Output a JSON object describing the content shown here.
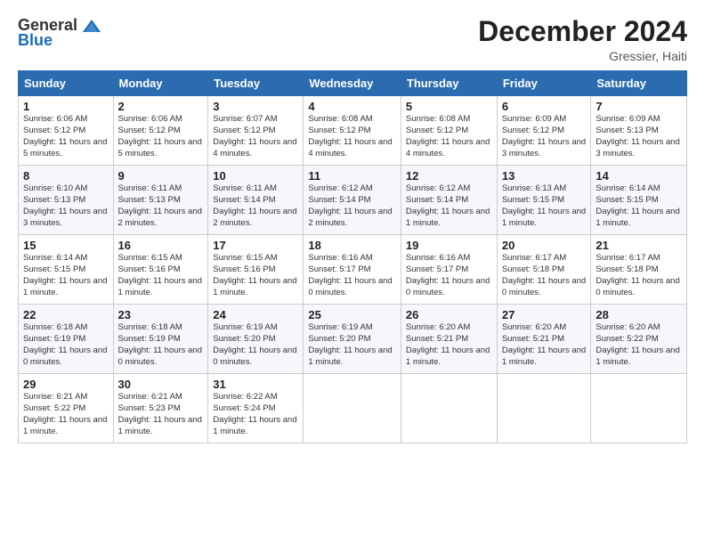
{
  "header": {
    "logo_general": "General",
    "logo_blue": "Blue",
    "month_title": "December 2024",
    "location": "Gressier, Haiti"
  },
  "days_of_week": [
    "Sunday",
    "Monday",
    "Tuesday",
    "Wednesday",
    "Thursday",
    "Friday",
    "Saturday"
  ],
  "weeks": [
    [
      {
        "num": "1",
        "sunrise": "Sunrise: 6:06 AM",
        "sunset": "Sunset: 5:12 PM",
        "daylight": "Daylight: 11 hours and 5 minutes."
      },
      {
        "num": "2",
        "sunrise": "Sunrise: 6:06 AM",
        "sunset": "Sunset: 5:12 PM",
        "daylight": "Daylight: 11 hours and 5 minutes."
      },
      {
        "num": "3",
        "sunrise": "Sunrise: 6:07 AM",
        "sunset": "Sunset: 5:12 PM",
        "daylight": "Daylight: 11 hours and 4 minutes."
      },
      {
        "num": "4",
        "sunrise": "Sunrise: 6:08 AM",
        "sunset": "Sunset: 5:12 PM",
        "daylight": "Daylight: 11 hours and 4 minutes."
      },
      {
        "num": "5",
        "sunrise": "Sunrise: 6:08 AM",
        "sunset": "Sunset: 5:12 PM",
        "daylight": "Daylight: 11 hours and 4 minutes."
      },
      {
        "num": "6",
        "sunrise": "Sunrise: 6:09 AM",
        "sunset": "Sunset: 5:12 PM",
        "daylight": "Daylight: 11 hours and 3 minutes."
      },
      {
        "num": "7",
        "sunrise": "Sunrise: 6:09 AM",
        "sunset": "Sunset: 5:13 PM",
        "daylight": "Daylight: 11 hours and 3 minutes."
      }
    ],
    [
      {
        "num": "8",
        "sunrise": "Sunrise: 6:10 AM",
        "sunset": "Sunset: 5:13 PM",
        "daylight": "Daylight: 11 hours and 3 minutes."
      },
      {
        "num": "9",
        "sunrise": "Sunrise: 6:11 AM",
        "sunset": "Sunset: 5:13 PM",
        "daylight": "Daylight: 11 hours and 2 minutes."
      },
      {
        "num": "10",
        "sunrise": "Sunrise: 6:11 AM",
        "sunset": "Sunset: 5:14 PM",
        "daylight": "Daylight: 11 hours and 2 minutes."
      },
      {
        "num": "11",
        "sunrise": "Sunrise: 6:12 AM",
        "sunset": "Sunset: 5:14 PM",
        "daylight": "Daylight: 11 hours and 2 minutes."
      },
      {
        "num": "12",
        "sunrise": "Sunrise: 6:12 AM",
        "sunset": "Sunset: 5:14 PM",
        "daylight": "Daylight: 11 hours and 1 minute."
      },
      {
        "num": "13",
        "sunrise": "Sunrise: 6:13 AM",
        "sunset": "Sunset: 5:15 PM",
        "daylight": "Daylight: 11 hours and 1 minute."
      },
      {
        "num": "14",
        "sunrise": "Sunrise: 6:14 AM",
        "sunset": "Sunset: 5:15 PM",
        "daylight": "Daylight: 11 hours and 1 minute."
      }
    ],
    [
      {
        "num": "15",
        "sunrise": "Sunrise: 6:14 AM",
        "sunset": "Sunset: 5:15 PM",
        "daylight": "Daylight: 11 hours and 1 minute."
      },
      {
        "num": "16",
        "sunrise": "Sunrise: 6:15 AM",
        "sunset": "Sunset: 5:16 PM",
        "daylight": "Daylight: 11 hours and 1 minute."
      },
      {
        "num": "17",
        "sunrise": "Sunrise: 6:15 AM",
        "sunset": "Sunset: 5:16 PM",
        "daylight": "Daylight: 11 hours and 1 minute."
      },
      {
        "num": "18",
        "sunrise": "Sunrise: 6:16 AM",
        "sunset": "Sunset: 5:17 PM",
        "daylight": "Daylight: 11 hours and 0 minutes."
      },
      {
        "num": "19",
        "sunrise": "Sunrise: 6:16 AM",
        "sunset": "Sunset: 5:17 PM",
        "daylight": "Daylight: 11 hours and 0 minutes."
      },
      {
        "num": "20",
        "sunrise": "Sunrise: 6:17 AM",
        "sunset": "Sunset: 5:18 PM",
        "daylight": "Daylight: 11 hours and 0 minutes."
      },
      {
        "num": "21",
        "sunrise": "Sunrise: 6:17 AM",
        "sunset": "Sunset: 5:18 PM",
        "daylight": "Daylight: 11 hours and 0 minutes."
      }
    ],
    [
      {
        "num": "22",
        "sunrise": "Sunrise: 6:18 AM",
        "sunset": "Sunset: 5:19 PM",
        "daylight": "Daylight: 11 hours and 0 minutes."
      },
      {
        "num": "23",
        "sunrise": "Sunrise: 6:18 AM",
        "sunset": "Sunset: 5:19 PM",
        "daylight": "Daylight: 11 hours and 0 minutes."
      },
      {
        "num": "24",
        "sunrise": "Sunrise: 6:19 AM",
        "sunset": "Sunset: 5:20 PM",
        "daylight": "Daylight: 11 hours and 0 minutes."
      },
      {
        "num": "25",
        "sunrise": "Sunrise: 6:19 AM",
        "sunset": "Sunset: 5:20 PM",
        "daylight": "Daylight: 11 hours and 1 minute."
      },
      {
        "num": "26",
        "sunrise": "Sunrise: 6:20 AM",
        "sunset": "Sunset: 5:21 PM",
        "daylight": "Daylight: 11 hours and 1 minute."
      },
      {
        "num": "27",
        "sunrise": "Sunrise: 6:20 AM",
        "sunset": "Sunset: 5:21 PM",
        "daylight": "Daylight: 11 hours and 1 minute."
      },
      {
        "num": "28",
        "sunrise": "Sunrise: 6:20 AM",
        "sunset": "Sunset: 5:22 PM",
        "daylight": "Daylight: 11 hours and 1 minute."
      }
    ],
    [
      {
        "num": "29",
        "sunrise": "Sunrise: 6:21 AM",
        "sunset": "Sunset: 5:22 PM",
        "daylight": "Daylight: 11 hours and 1 minute."
      },
      {
        "num": "30",
        "sunrise": "Sunrise: 6:21 AM",
        "sunset": "Sunset: 5:23 PM",
        "daylight": "Daylight: 11 hours and 1 minute."
      },
      {
        "num": "31",
        "sunrise": "Sunrise: 6:22 AM",
        "sunset": "Sunset: 5:24 PM",
        "daylight": "Daylight: 11 hours and 1 minute."
      },
      null,
      null,
      null,
      null
    ]
  ]
}
